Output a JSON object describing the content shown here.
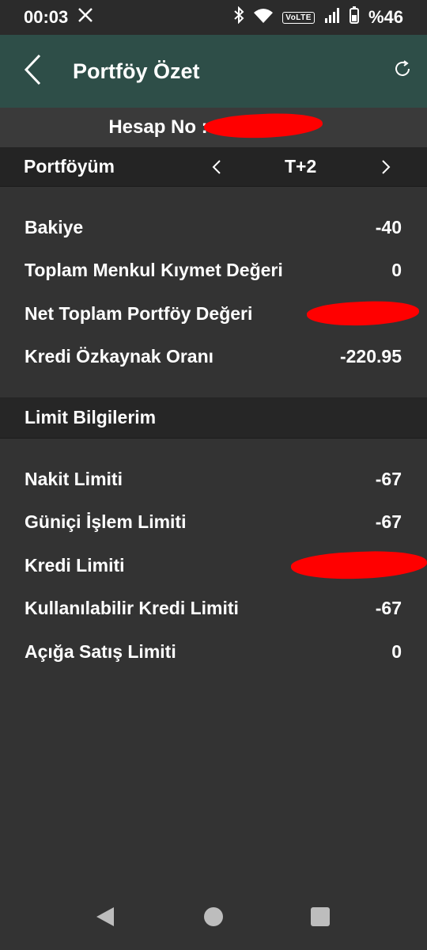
{
  "status": {
    "time": "00:03",
    "x_icon": "x-logo-icon",
    "volte": "VoLTE",
    "battery": "%46"
  },
  "header": {
    "title": "Portföy Özet",
    "back_icon": "back-chevron-icon",
    "refresh_icon": "refresh-icon"
  },
  "account": {
    "label": "Hesap No :"
  },
  "portfolio_bar": {
    "label": "Portföyüm",
    "period": "T+2"
  },
  "summary": [
    {
      "label": "Bakiye",
      "value": "-40"
    },
    {
      "label": "Toplam Menkul Kıymet Değeri",
      "value": "0"
    },
    {
      "label": "Net Toplam Portföy Değeri",
      "value": ""
    },
    {
      "label": "Kredi Özkaynak Oranı",
      "value": "-220.95"
    }
  ],
  "limits": {
    "title": "Limit Bilgilerim",
    "rows": [
      {
        "label": "Nakit Limiti",
        "value": "-67"
      },
      {
        "label": "Güniçi İşlem Limiti",
        "value": "-67"
      },
      {
        "label": "Kredi Limiti",
        "value": ""
      },
      {
        "label": "Kullanılabilir Kredi Limiti",
        "value": "-67"
      },
      {
        "label": "Açığa Satış Limiti",
        "value": "0"
      }
    ]
  },
  "colors": {
    "appbar": "#2e4e48",
    "background": "#333333",
    "redaction": "#ff0000"
  }
}
